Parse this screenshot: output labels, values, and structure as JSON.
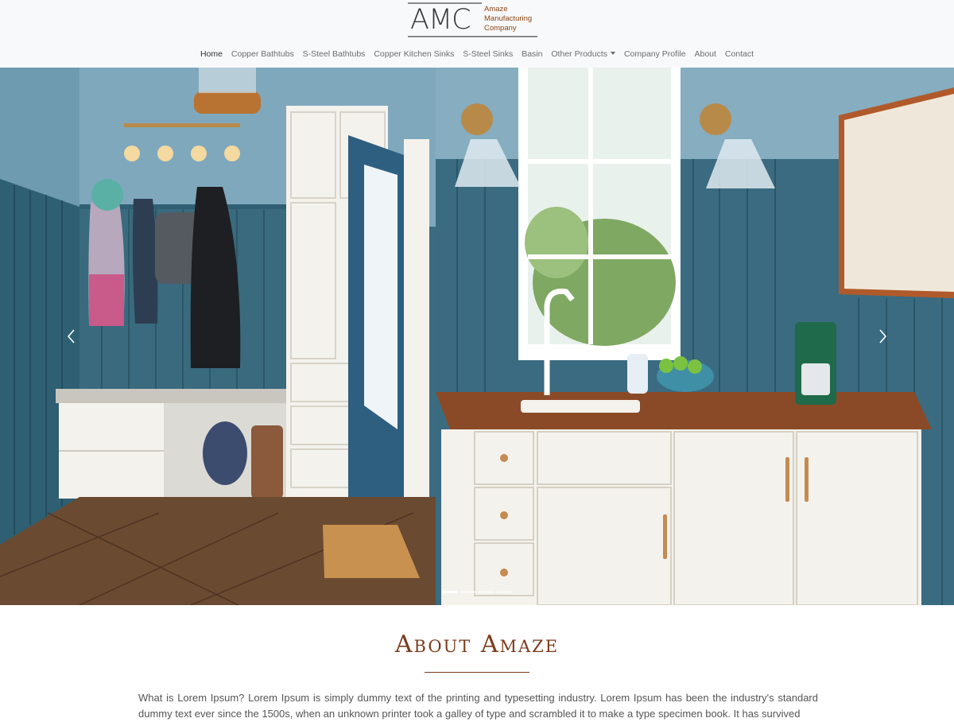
{
  "logo": {
    "mark": "AMC",
    "name_lines": [
      "Amaze",
      "Manufacturing",
      "Company"
    ]
  },
  "nav": {
    "items": [
      {
        "label": "Home",
        "active": true
      },
      {
        "label": "Copper Bathtubs"
      },
      {
        "label": "S-Steel Bathtubs"
      },
      {
        "label": "Copper Kitchen Sinks"
      },
      {
        "label": "S-Steel Sinks"
      },
      {
        "label": "Basin"
      },
      {
        "label": "Other Products",
        "dropdown": true
      },
      {
        "label": "Company Profile"
      },
      {
        "label": "About"
      },
      {
        "label": "Contact"
      }
    ]
  },
  "hero": {
    "slide_count": 4,
    "active_slide": 1,
    "icons": {
      "prev": "chevron-left-icon",
      "next": "chevron-right-icon"
    }
  },
  "about": {
    "title": "About Amaze",
    "paragraph": "What is Lorem Ipsum? Lorem Ipsum is simply dummy text of the printing and typesetting industry. Lorem Ipsum has been the industry's standard dummy text ever since the 1500s, when an unknown printer took a galley of type and scrambled it to make a type specimen book. It has survived"
  },
  "colors": {
    "brand_brown": "#7a3b1c",
    "header_bg": "#f8f9fa",
    "wall_teal": "#3d6b7f"
  }
}
